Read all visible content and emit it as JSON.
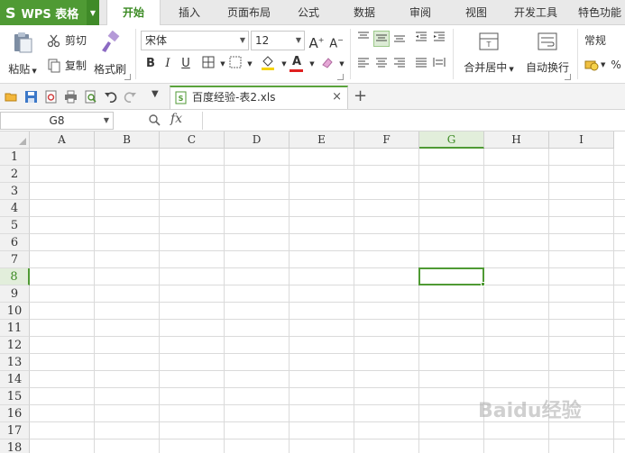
{
  "app": {
    "logo": "S",
    "title": "WPS 表格"
  },
  "ribbon_tabs": [
    {
      "label": "开始",
      "active": true
    },
    {
      "label": "插入"
    },
    {
      "label": "页面布局"
    },
    {
      "label": "公式"
    },
    {
      "label": "数据"
    },
    {
      "label": "审阅"
    },
    {
      "label": "视图"
    },
    {
      "label": "开发工具"
    },
    {
      "label": "特色功能"
    }
  ],
  "clipboard": {
    "paste": "粘贴",
    "cut": "剪切",
    "copy": "复制",
    "format_painter": "格式刷"
  },
  "font": {
    "name": "宋体",
    "size": "12",
    "bold": "B",
    "italic": "I",
    "underline": "U",
    "grow": "A",
    "shrink": "A",
    "font_color": "A",
    "fill_color": "red-underline"
  },
  "alignment": {
    "merge_center": "合并居中",
    "wrap_text": "自动换行"
  },
  "number": {
    "format": "常规",
    "percent": "%"
  },
  "document_tab": {
    "name": "百度经验-表2.xls",
    "close": "×",
    "new_tab": "+"
  },
  "formula_bar": {
    "cell_ref": "G8",
    "fx": "fx"
  },
  "sheet": {
    "columns": [
      "A",
      "B",
      "C",
      "D",
      "E",
      "F",
      "G",
      "H",
      "I"
    ],
    "rows": [
      "1",
      "2",
      "3",
      "4",
      "5",
      "6",
      "7",
      "8",
      "9",
      "10",
      "11",
      "12",
      "13",
      "14",
      "15",
      "16",
      "17",
      "18"
    ],
    "selected_column": "G",
    "selected_row": "8"
  },
  "watermark": "Baidu经验",
  "colors": {
    "accent": "#4f9a34",
    "active_tab_text": "#3b8a23",
    "font_color_bar": "#e02020",
    "fill_color_bar": "#f5d300"
  }
}
